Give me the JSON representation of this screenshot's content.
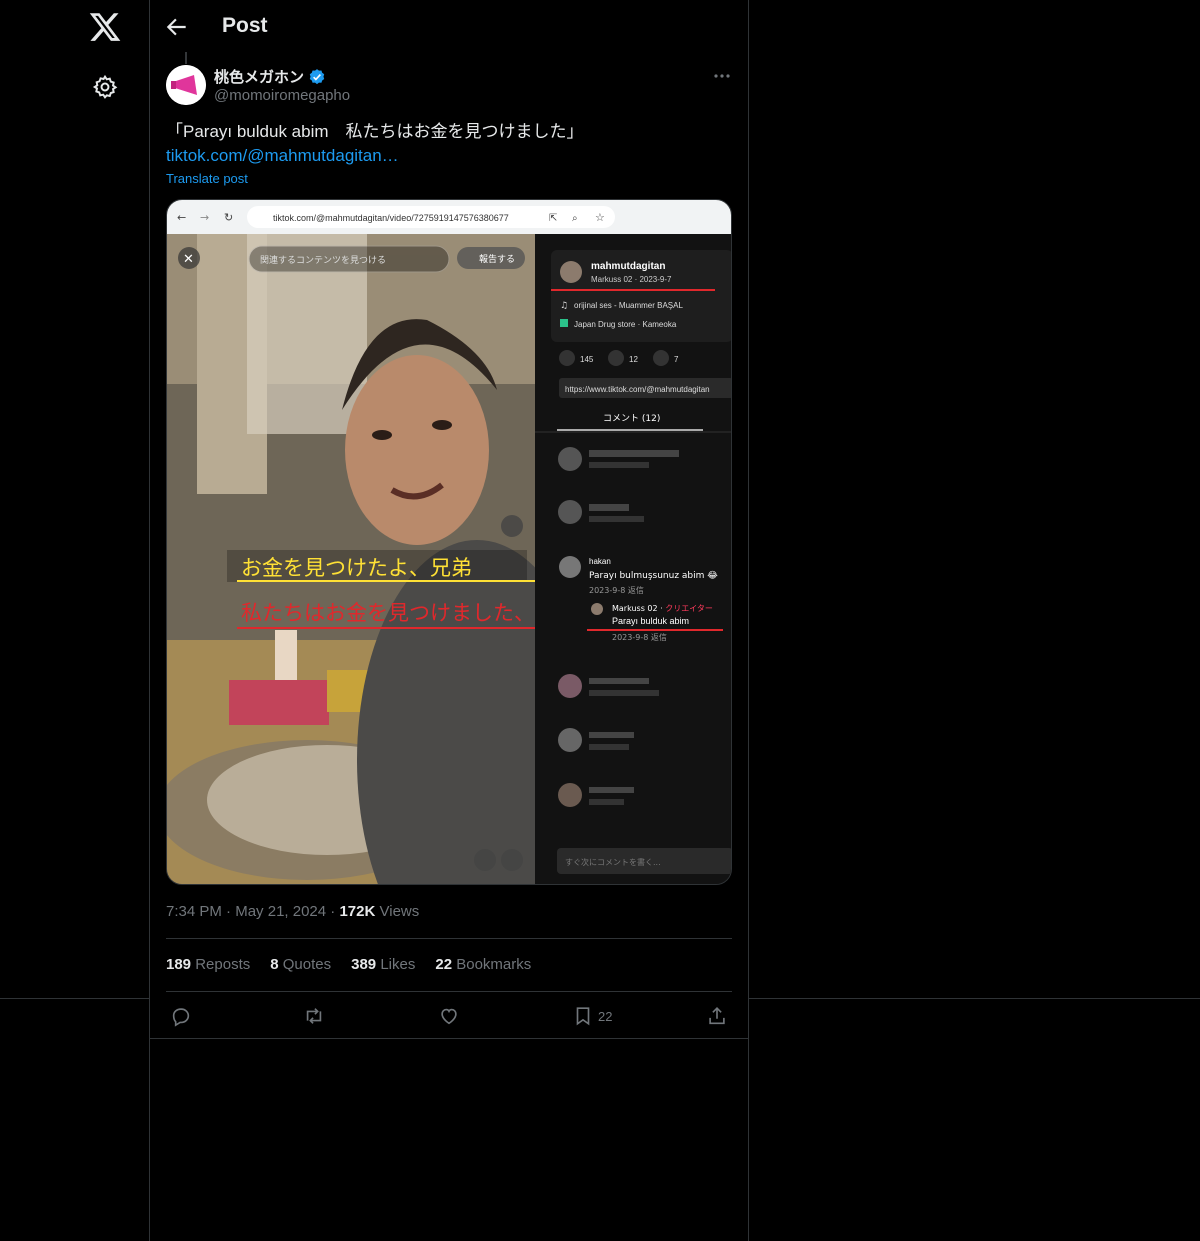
{
  "nav": {
    "logo_icon": "x-logo-icon",
    "settings_icon": "gear-icon"
  },
  "header": {
    "title": "Post"
  },
  "post": {
    "author_name": "桃色メガホン",
    "author_handle": "@momoiromegapho",
    "text": "「Parayı bulduk abim　私たちはお金を見つけました」",
    "link_text": "tiktok.com/@mahmutdagitan…",
    "translate_label": "Translate post",
    "time": "7:34 PM",
    "date": "May 21, 2024",
    "views_count": "172K",
    "views_label": "Views"
  },
  "stats": {
    "reposts_count": "189",
    "reposts_label": "Reposts",
    "quotes_count": "8",
    "quotes_label": "Quotes",
    "likes_count": "389",
    "likes_label": "Likes",
    "bookmarks_count": "22",
    "bookmarks_label": "Bookmarks"
  },
  "actions": {
    "bookmark_count": "22"
  },
  "screenshot": {
    "url": "tiktok.com/@mahmutdagitan/video/7275919147576380677",
    "search_placeholder": "関連するコンテンツを見つける",
    "report_label": "報告する",
    "creator_name": "mahmutdagitan",
    "creator_sub": "Markuss 02 · 2023-9-7",
    "sound": "orijinal ses - Muammer BAŞAL",
    "location": "Japan Drug store · Kameoka",
    "likes": "145",
    "comments": "12",
    "saves": "7",
    "link_box": "https://www.tiktok.com/@mahmutdagitan",
    "comments_tab": "コメント (12)",
    "comment_hakan_name": "hakan",
    "comment_hakan_text": "Parayı bulmuşsunuz abim 😂",
    "comment_hakan_date": "2023-9-8 返信",
    "reply_name": "Markuss 02 · ",
    "reply_creator": "クリエイター",
    "reply_text": "Parayı bulduk abim",
    "reply_date": "2023-9-8 返信",
    "caption_yellow": "お金を見つけたよ、兄弟",
    "caption_red": "私たちはお金を見つけました、兄弟",
    "comment_input": "すぐ次にコメントを書く..."
  }
}
